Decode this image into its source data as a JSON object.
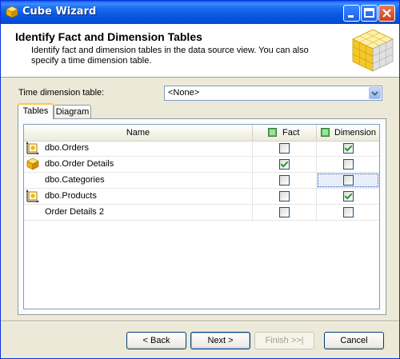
{
  "window": {
    "title": "Cube Wizard",
    "buttons": [
      "minimize",
      "maximize",
      "close"
    ]
  },
  "header": {
    "title": "Identify Fact and Dimension Tables",
    "description": "Identify fact and dimension tables in the data source view. You can also specify a time dimension table."
  },
  "time_dimension": {
    "label": "Time dimension table:",
    "value": "<None>"
  },
  "tabs": [
    {
      "label": "Tables",
      "active": true
    },
    {
      "label": "Diagram",
      "active": false
    }
  ],
  "grid": {
    "columns": {
      "name": "Name",
      "fact": "Fact",
      "dimension": "Dimension"
    },
    "rows": [
      {
        "name": "dbo.Orders",
        "icon": "time-dimension-icon",
        "fact": false,
        "dimension": true
      },
      {
        "name": "dbo.Order Details",
        "icon": "cube-icon",
        "fact": true,
        "dimension": false
      },
      {
        "name": "dbo.Categories",
        "icon": "",
        "fact": false,
        "dimension": false
      },
      {
        "name": "dbo.Products",
        "icon": "time-dimension-icon",
        "fact": false,
        "dimension": true
      },
      {
        "name": "Order Details 2",
        "icon": "",
        "fact": false,
        "dimension": false
      }
    ]
  },
  "buttons": {
    "back": "< Back",
    "next": "Next >",
    "finish": "Finish >>|",
    "cancel": "Cancel"
  },
  "colors": {
    "titlebar": "#0a58e4",
    "accent_tab": "#ffc83c",
    "check": "#21a121"
  }
}
